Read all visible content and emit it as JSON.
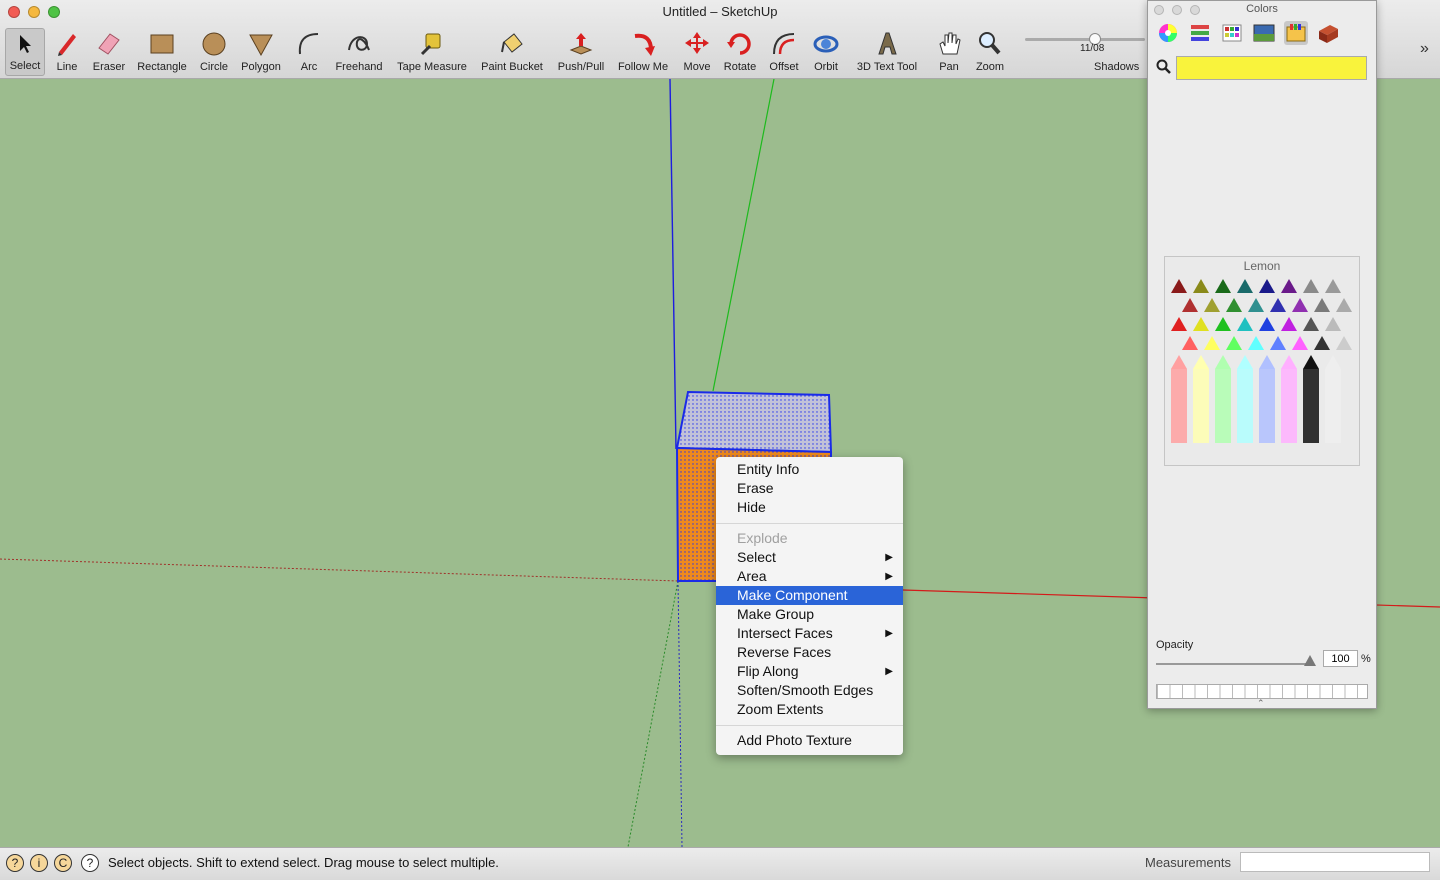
{
  "window": {
    "title": "Untitled – SketchUp"
  },
  "toolbar": {
    "tools": [
      {
        "label": "Select",
        "icon": "arrow-cursor-icon"
      },
      {
        "label": "Line",
        "icon": "pencil-icon"
      },
      {
        "label": "Eraser",
        "icon": "eraser-icon"
      },
      {
        "label": "Rectangle",
        "icon": "rectangle-icon"
      },
      {
        "label": "Circle",
        "icon": "circle-icon"
      },
      {
        "label": "Polygon",
        "icon": "polygon-icon"
      },
      {
        "label": "Arc",
        "icon": "arc-icon"
      },
      {
        "label": "Freehand",
        "icon": "freehand-icon"
      },
      {
        "label": "Tape Measure",
        "icon": "tape-measure-icon"
      },
      {
        "label": "Paint Bucket",
        "icon": "paint-bucket-icon"
      },
      {
        "label": "Push/Pull",
        "icon": "push-pull-icon"
      },
      {
        "label": "Follow Me",
        "icon": "follow-me-icon"
      },
      {
        "label": "Move",
        "icon": "move-icon"
      },
      {
        "label": "Rotate",
        "icon": "rotate-icon"
      },
      {
        "label": "Offset",
        "icon": "offset-icon"
      },
      {
        "label": "Orbit",
        "icon": "orbit-icon"
      },
      {
        "label": "3D Text Tool",
        "icon": "3d-text-icon"
      },
      {
        "label": "Pan",
        "icon": "hand-icon"
      },
      {
        "label": "Zoom",
        "icon": "magnifier-icon"
      }
    ],
    "shadows": {
      "label": "Shadows",
      "date": "11/08"
    }
  },
  "context_menu": {
    "items": [
      {
        "label": "Entity Info"
      },
      {
        "label": "Erase"
      },
      {
        "label": "Hide"
      },
      {
        "label": "Explode",
        "disabled": true
      },
      {
        "label": "Select",
        "submenu": true
      },
      {
        "label": "Area",
        "submenu": true
      },
      {
        "label": "Make Component",
        "highlighted": true
      },
      {
        "label": "Make Group"
      },
      {
        "label": "Intersect Faces",
        "submenu": true
      },
      {
        "label": "Reverse Faces"
      },
      {
        "label": "Flip Along",
        "submenu": true
      },
      {
        "label": "Soften/Smooth Edges"
      },
      {
        "label": "Zoom Extents"
      },
      {
        "label": "Add Photo Texture"
      }
    ],
    "submenu_arrow": "▶"
  },
  "colors_panel": {
    "title": "Colors",
    "selected_color": "#f9f33c",
    "crayon_name": "Lemon",
    "opacity_label": "Opacity",
    "opacity_value": "100",
    "opacity_unit": "%",
    "tabs": [
      "color-wheel-icon",
      "color-sliders-icon",
      "color-palettes-icon",
      "image-palettes-icon",
      "crayons-icon",
      "materials-icon"
    ]
  },
  "status_bar": {
    "message": "Select objects. Shift to extend select. Drag mouse to select multiple.",
    "measurements_label": "Measurements",
    "measurements_value": ""
  },
  "colors": {
    "viewport_bg": "#9cbc8e",
    "selection_blue": "#2233ee",
    "face_top": "#c2c2d8",
    "face_front": "#f08a1c",
    "axis_red": "#d41a1a",
    "axis_green": "#1dba1d",
    "axis_blue": "#1c1ce0",
    "menu_highlight": "#2a64d8"
  }
}
